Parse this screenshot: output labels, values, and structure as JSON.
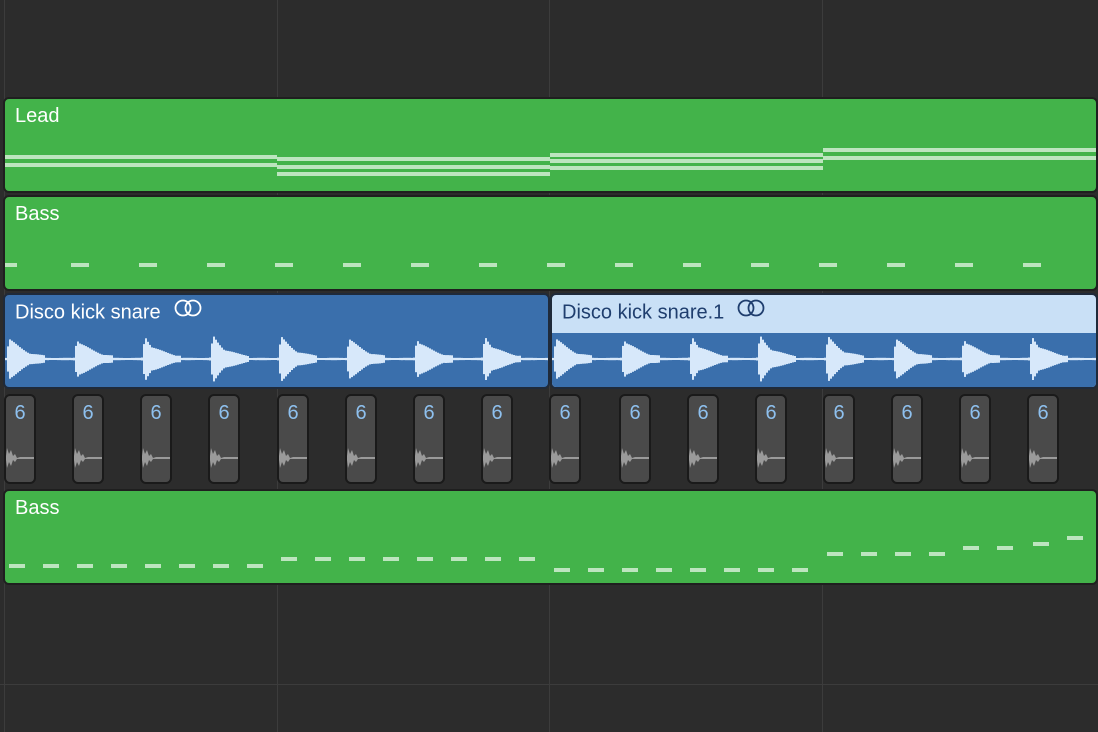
{
  "tracks": {
    "lead": {
      "name": "Lead"
    },
    "bass1": {
      "name": "Bass"
    },
    "disco1": {
      "name": "Disco kick snare",
      "icon": "loop-icon"
    },
    "disco2": {
      "name": "Disco kick snare.1",
      "icon": "loop-icon"
    },
    "bass2": {
      "name": "Bass"
    }
  },
  "segments": [
    {
      "label": "6"
    },
    {
      "label": "6"
    },
    {
      "label": "6"
    },
    {
      "label": "6"
    },
    {
      "label": "6"
    },
    {
      "label": "6"
    },
    {
      "label": "6"
    },
    {
      "label": "6"
    },
    {
      "label": "6"
    },
    {
      "label": "6"
    },
    {
      "label": "6"
    },
    {
      "label": "6"
    },
    {
      "label": "6"
    },
    {
      "label": "6"
    },
    {
      "label": "6"
    },
    {
      "label": "6"
    }
  ],
  "colors": {
    "midi_region": "#43b34a",
    "audio_region_dark": "#3a6fac",
    "audio_region_selected": "#c9e0f6",
    "segment_number": "#8ec0ee"
  }
}
